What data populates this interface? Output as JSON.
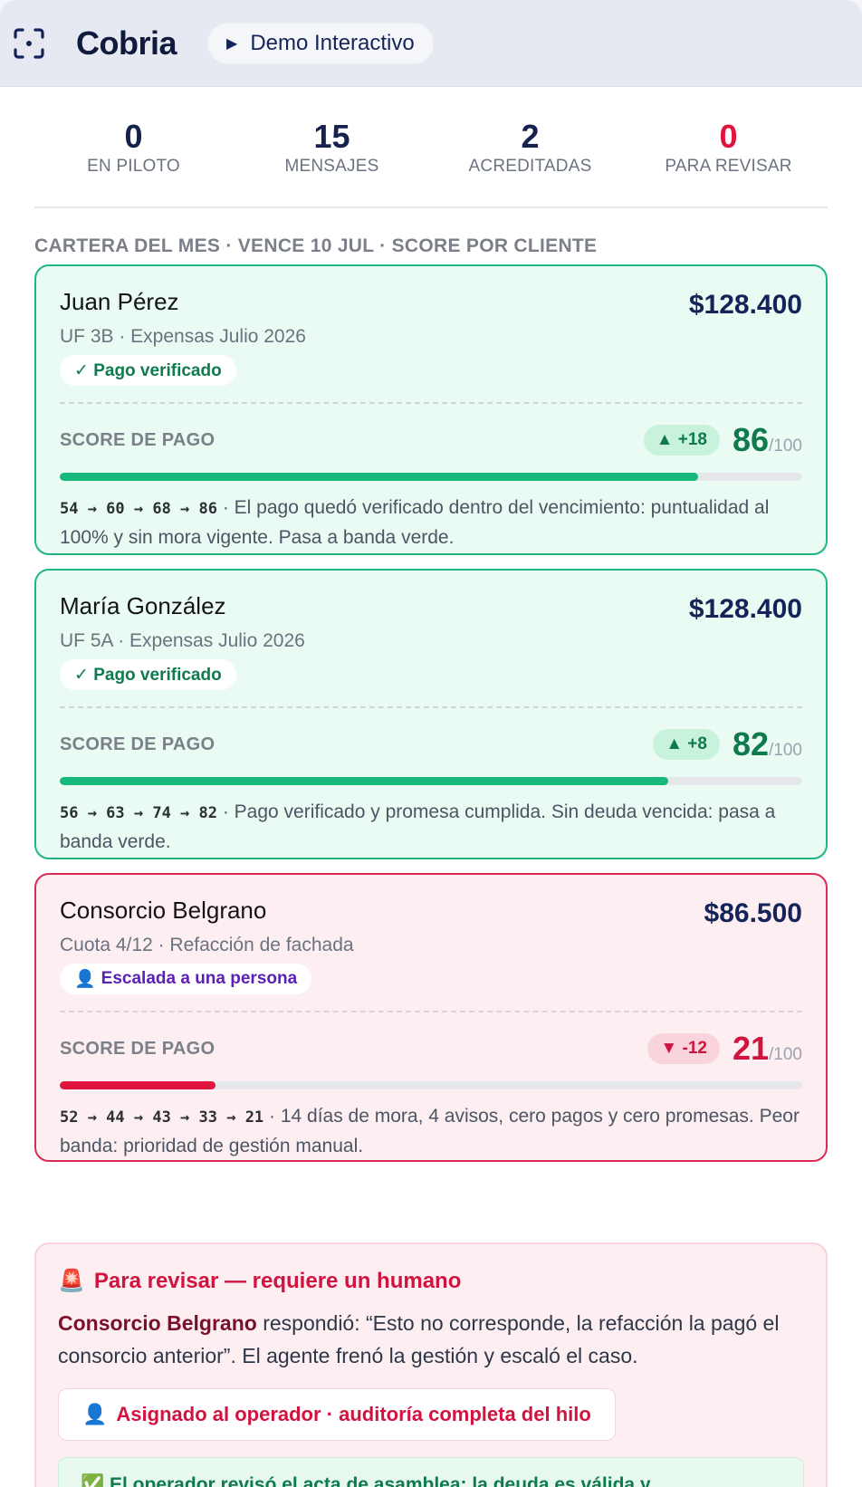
{
  "header": {
    "brand": "Cobria",
    "demo_label": "Demo Interactivo"
  },
  "stats": [
    {
      "value": "0",
      "label": "EN PILOTO"
    },
    {
      "value": "15",
      "label": "MENSAJES"
    },
    {
      "value": "2",
      "label": "ACREDITADAS"
    },
    {
      "value": "0",
      "label": "PARA REVISAR"
    }
  ],
  "section_title": "CARTERA DEL MES · VENCE 10 JUL · SCORE POR CLIENTE",
  "cards": [
    {
      "name": "Juan Pérez",
      "amount": "$128.400",
      "subtitle": "UF 3B · Expensas Julio 2026",
      "badge": "✓ Pago verificado",
      "score_label": "SCORE DE PAGO",
      "delta": "▲ +18",
      "score": "86",
      "score_max": "/100",
      "score_fraction": 0.86,
      "trail": "54 → 60 → 68 → 86",
      "description": " · El pago quedó verificado dentro del vencimiento: puntualidad al 100% y sin mora vigente. Pasa a banda verde."
    },
    {
      "name": "María González",
      "amount": "$128.400",
      "subtitle": "UF 5A · Expensas Julio 2026",
      "badge": "✓ Pago verificado",
      "score_label": "SCORE DE PAGO",
      "delta": "▲ +8",
      "score": "82",
      "score_max": "/100",
      "score_fraction": 0.82,
      "trail": "56 → 63 → 74 → 82",
      "description": " · Pago verificado y promesa cumplida. Sin deuda vencida: pasa a banda verde."
    },
    {
      "name": "Consorcio Belgrano",
      "amount": "$86.500",
      "subtitle": "Cuota 4/12 · Refacción de fachada",
      "badge": "Escalada a una persona",
      "score_label": "SCORE DE PAGO",
      "delta": "▼ -12",
      "score": "21",
      "score_max": "/100",
      "score_fraction": 0.21,
      "trail": "52 → 44 → 43 → 33 → 21",
      "description": " · 14 días de mora, 4 avisos, cero pagos y cero promesas. Peor banda: prioridad de gestión manual."
    }
  ],
  "alert": {
    "title": "Para revisar — requiere un humano",
    "client": "Consorcio Belgrano",
    "message": " respondió: “Esto no corresponde, la refacción la pagó el consorcio anterior”. El agente frenó la gestión y escaló el caso.",
    "assign_label": "Asignado al operador · auditoría completa del hilo",
    "resolution": "El operador revisó el acta de asamblea: la deuda es válida y"
  },
  "colors": {
    "green": "#16b97a",
    "red": "#e0143e",
    "navy": "#142459"
  }
}
